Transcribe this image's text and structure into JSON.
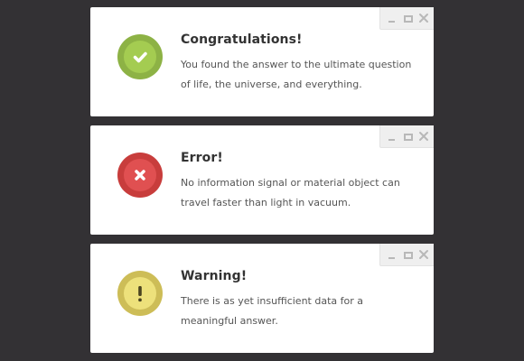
{
  "colors": {
    "background": "#333134",
    "card": "#ffffff",
    "success": "#a4cc51",
    "error": "#e05051",
    "warning": "#ede17b"
  },
  "notifications": [
    {
      "type": "success",
      "icon": "checkmark-icon",
      "title": "Congratulations!",
      "message": "You found the answer to the ultimate question of life, the universe, and everything."
    },
    {
      "type": "error",
      "icon": "x-icon",
      "title": "Error!",
      "message": "No information signal or material object can travel faster than light in vacuum."
    },
    {
      "type": "warning",
      "icon": "exclamation-icon",
      "title": "Warning!",
      "message": "There is as yet insufficient data for a meaningful answer."
    }
  ],
  "window_controls": [
    "minimize-icon",
    "maximize-icon",
    "close-icon"
  ]
}
